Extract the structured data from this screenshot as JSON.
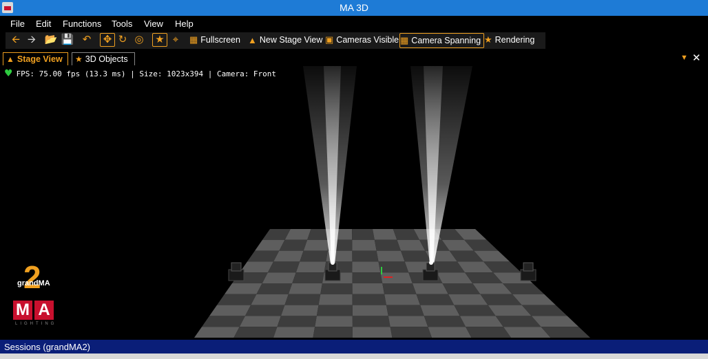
{
  "window": {
    "title": "MA 3D",
    "icon": "ma-app-icon"
  },
  "menu": [
    {
      "id": "file",
      "label": "File"
    },
    {
      "id": "edit",
      "label": "Edit"
    },
    {
      "id": "functions",
      "label": "Functions"
    },
    {
      "id": "tools",
      "label": "Tools"
    },
    {
      "id": "view",
      "label": "View"
    },
    {
      "id": "help",
      "label": "Help"
    }
  ],
  "toolbar": {
    "fullscreen_label": "Fullscreen",
    "new_stage_view_label": "New Stage View",
    "cameras_visible_label": "Cameras Visible",
    "camera_spanning_label": "Camera Spanning",
    "rendering_label": "Rendering",
    "accent_color": "#f0a020"
  },
  "tabs": [
    {
      "id": "stage-view",
      "label": "Stage View",
      "active": true
    },
    {
      "id": "3d-objects",
      "label": "3D Objects",
      "active": false
    }
  ],
  "viewport": {
    "info": "FPS: 75.00 fps (13.3 ms) | Size: 1023x394 | Camera: Front"
  },
  "logo": {
    "number": "2",
    "brand": "grandMA",
    "m": "M",
    "a": "A",
    "tagline": "LIGHTING"
  },
  "status": {
    "sessions": "Sessions (grandMA2)"
  },
  "colors": {
    "title_bar": "#1e7bd6",
    "status_bar": "#0a1e78",
    "accent": "#f0a020",
    "ma_red": "#c8102e"
  }
}
